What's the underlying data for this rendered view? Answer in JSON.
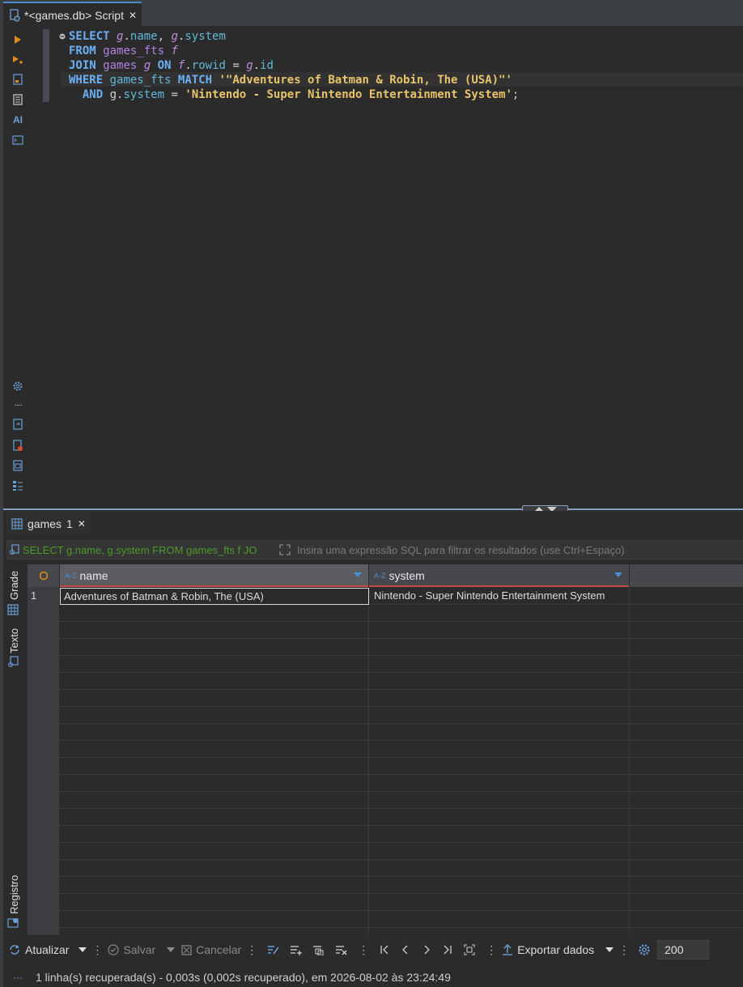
{
  "editor_tab": {
    "title": "*<games.db> Script",
    "close": "✕"
  },
  "gutter_icons": [
    "run-statement-icon",
    "run-script-icon",
    "explain-plan-icon",
    "load-script-icon",
    "ai-assist-icon",
    "open-console-icon",
    "settings-icon",
    "more-icon",
    "export-script-icon",
    "problems-icon",
    "output-icon",
    "outline-icon"
  ],
  "gutter_labels": {
    "ai": "AI",
    "more": "····"
  },
  "sql": {
    "line1": {
      "kw": "SELECT",
      "a1": "g",
      "c1": "name",
      "a2": "g",
      "c2": "system"
    },
    "line2": {
      "kw": "FROM",
      "tbl": "games_fts",
      "alias": "f"
    },
    "line3": {
      "kw": "JOIN",
      "tbl": "games",
      "alias": "g",
      "on": "ON",
      "a1": "f",
      "c1": "rowid",
      "a2": "g",
      "c2": "id"
    },
    "line4": {
      "kw": "WHERE",
      "tbl": "games_fts",
      "match": "MATCH",
      "str": "'\"Adventures of Batman & Robin, The (USA)\"'"
    },
    "line5": {
      "kw": "AND",
      "a1": "g",
      "c1": "system",
      "str": "'Nintendo - Super Nintendo Entertainment System'"
    }
  },
  "results_tab": {
    "label": "games",
    "count": "1",
    "close": "✕"
  },
  "filter": {
    "sql_preview": "SELECT g.name, g.system FROM games_fts f JO",
    "placeholder": "Insira uma expressão SQL para filtrar os resultados (use Ctrl+Espaço)"
  },
  "side_tabs": {
    "grid": "Grade",
    "text": "Texto",
    "record": "Registro"
  },
  "grid": {
    "type_badge": "A-Z",
    "columns": [
      "name",
      "system"
    ],
    "rows": [
      {
        "num": "1",
        "name": "Adventures of Batman & Robin, The (USA)",
        "system": "Nintendo - Super Nintendo Entertainment System"
      }
    ]
  },
  "toolbar": {
    "refresh": "Atualizar",
    "save": "Salvar",
    "cancel": "Cancelar",
    "export": "Exportar dados",
    "limit": "200"
  },
  "status": {
    "text": "1 linha(s) recuperada(s) - 0,003s (0,002s recuperado), em 2026-08-02 às 23:24:49",
    "more": "···"
  },
  "colors": {
    "accent": "#4a88c7",
    "keyword": "#6ab0f3",
    "string": "#e8c46a",
    "filter_sql": "#4c9a2a"
  }
}
